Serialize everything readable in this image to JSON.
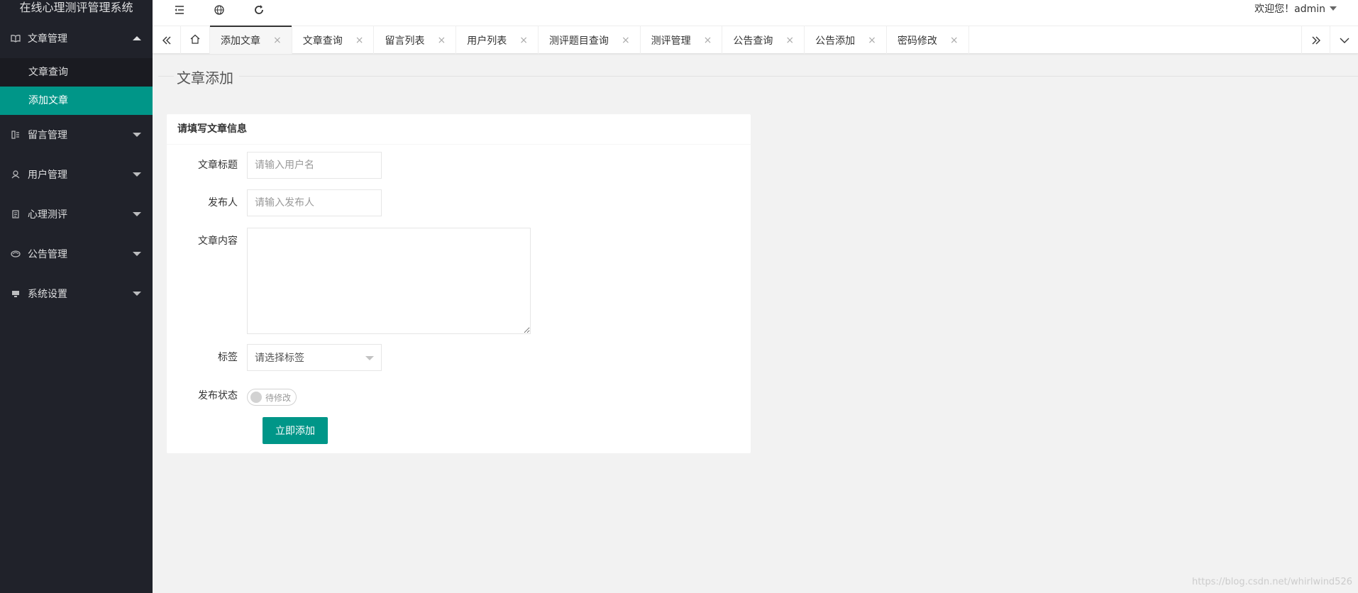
{
  "app": {
    "title": "在线心理测评管理系统"
  },
  "sidebar": {
    "groups": [
      {
        "label": "文章管理",
        "icon": "book-icon",
        "expanded": true,
        "items": [
          {
            "label": "文章查询"
          },
          {
            "label": "添加文章",
            "active": true
          }
        ]
      },
      {
        "label": "留言管理",
        "icon": "message-icon"
      },
      {
        "label": "用户管理",
        "icon": "user-icon"
      },
      {
        "label": "心理测评",
        "icon": "clipboard-icon"
      },
      {
        "label": "公告管理",
        "icon": "notice-icon"
      },
      {
        "label": "系统设置",
        "icon": "monitor-icon"
      }
    ]
  },
  "header": {
    "icons": [
      "menu-fold-icon",
      "globe-icon",
      "refresh-icon"
    ],
    "welcome": "欢迎您！admin"
  },
  "tabs": {
    "items": [
      {
        "label": "添加文章",
        "active": true
      },
      {
        "label": "文章查询"
      },
      {
        "label": "留言列表"
      },
      {
        "label": "用户列表"
      },
      {
        "label": "测评题目查询"
      },
      {
        "label": "测评管理"
      },
      {
        "label": "公告查询"
      },
      {
        "label": "公告添加"
      },
      {
        "label": "密码修改"
      }
    ],
    "close_glyph": "×"
  },
  "page": {
    "title": "文章添加"
  },
  "form": {
    "card_title": "请填写文章信息",
    "title_label": "文章标题",
    "title_placeholder": "请输入用户名",
    "author_label": "发布人",
    "author_placeholder": "请输入发布人",
    "content_label": "文章内容",
    "tag_label": "标签",
    "tag_selected": "请选择标签",
    "status_label": "发布状态",
    "status_switch_text": "待修改",
    "submit_label": "立即添加"
  },
  "watermark": "https://blog.csdn.net/whirlwind526",
  "colors": {
    "accent": "#009688",
    "sidebar_bg": "#20222a"
  }
}
